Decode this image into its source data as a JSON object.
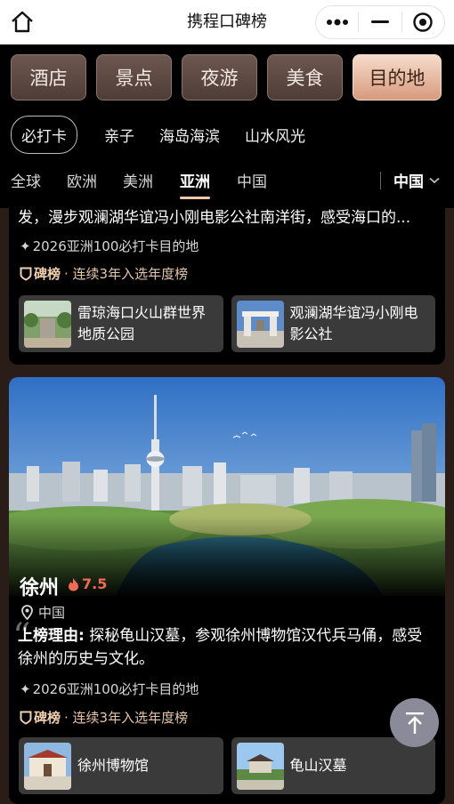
{
  "nav": {
    "title": "携程口碑榜",
    "home_icon": "home-icon",
    "more_icon": "more-dots-icon",
    "minimize_icon": "minimize-icon",
    "close_icon": "target-close-icon"
  },
  "categories": [
    {
      "label": "酒店",
      "active": false
    },
    {
      "label": "景点",
      "active": false
    },
    {
      "label": "夜游",
      "active": false
    },
    {
      "label": "美食",
      "active": false
    },
    {
      "label": "目的地",
      "active": true
    }
  ],
  "chips": [
    "必打卡",
    "亲子",
    "海岛海滨",
    "山水风光"
  ],
  "regions": [
    "全球",
    "欧洲",
    "美洲",
    "亚洲",
    "中国"
  ],
  "region_selected": "亚洲",
  "region_filter": "中国",
  "card1": {
    "desc": "发，漫步观澜湖华谊冯小刚电影公社南洋街，感受海口的...",
    "tag": "2026亚洲100必打卡目的地",
    "rank_brand": "碑榜",
    "rank_note": "· 连续3年入选年度榜",
    "pois": [
      {
        "name": "雷琼海口火山群世界地质公园"
      },
      {
        "name": "观澜湖华谊冯小刚电影公社"
      }
    ]
  },
  "card2": {
    "city": "徐州",
    "score": "7.5",
    "country": "中国",
    "reason_label": "上榜理由:",
    "reason_text": " 探秘龟山汉墓，参观徐州博物馆汉代兵马俑，感受徐州的历史与文化。",
    "tag": "2026亚洲100必打卡目的地",
    "rank_brand": "碑榜",
    "rank_note": "· 连续3年入选年度榜",
    "pois": [
      {
        "name": "徐州博物馆"
      },
      {
        "name": "龟山汉墓"
      }
    ]
  },
  "colors": {
    "accent": "#f3c8a7",
    "score": "#f06a56",
    "rank": "#e6c6a8"
  },
  "back_to_top_icon": "back-to-top-icon"
}
